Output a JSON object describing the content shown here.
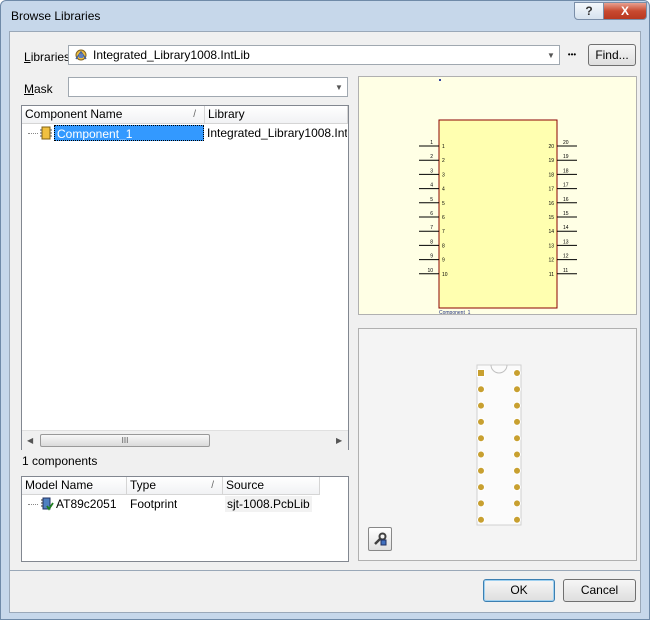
{
  "window": {
    "title": "Browse Libraries",
    "help_label": "?",
    "close_label": "X"
  },
  "libraries": {
    "label_underlined": "L",
    "label_rest": "ibraries",
    "selected": "Integrated_Library1008.IntLib",
    "more_label": "•••",
    "find_label": "Find..."
  },
  "mask": {
    "label_underlined": "M",
    "label_rest": "ask",
    "value": ""
  },
  "components": {
    "columns": [
      "Component Name",
      "Library"
    ],
    "sort_indicator": "/",
    "rows": [
      {
        "name": "Component_1",
        "library": "Integrated_Library1008.IntLib"
      }
    ],
    "scroll_grip": "III",
    "count_text": "1 components"
  },
  "models": {
    "columns": [
      "Model Name",
      "Type",
      "Source"
    ],
    "sort_indicator": "/",
    "rows": [
      {
        "name": "AT89c2051",
        "type": "Footprint",
        "source": "sjt-1008.PcbLib"
      }
    ]
  },
  "schematic": {
    "component_label": "Component_1",
    "left_pins": [
      "1",
      "2",
      "3",
      "4",
      "5",
      "6",
      "7",
      "8",
      "9",
      "10"
    ],
    "right_pins": [
      "20",
      "19",
      "18",
      "17",
      "16",
      "15",
      "14",
      "13",
      "12",
      "11"
    ]
  },
  "footer": {
    "ok_label": "OK",
    "cancel_label": "Cancel"
  },
  "colors": {
    "selection": "#3399ff",
    "schematic_bg": "#ffffe5",
    "body_fill": "#ffffb0",
    "body_border": "#8b0000",
    "pad": "#c8a030"
  }
}
